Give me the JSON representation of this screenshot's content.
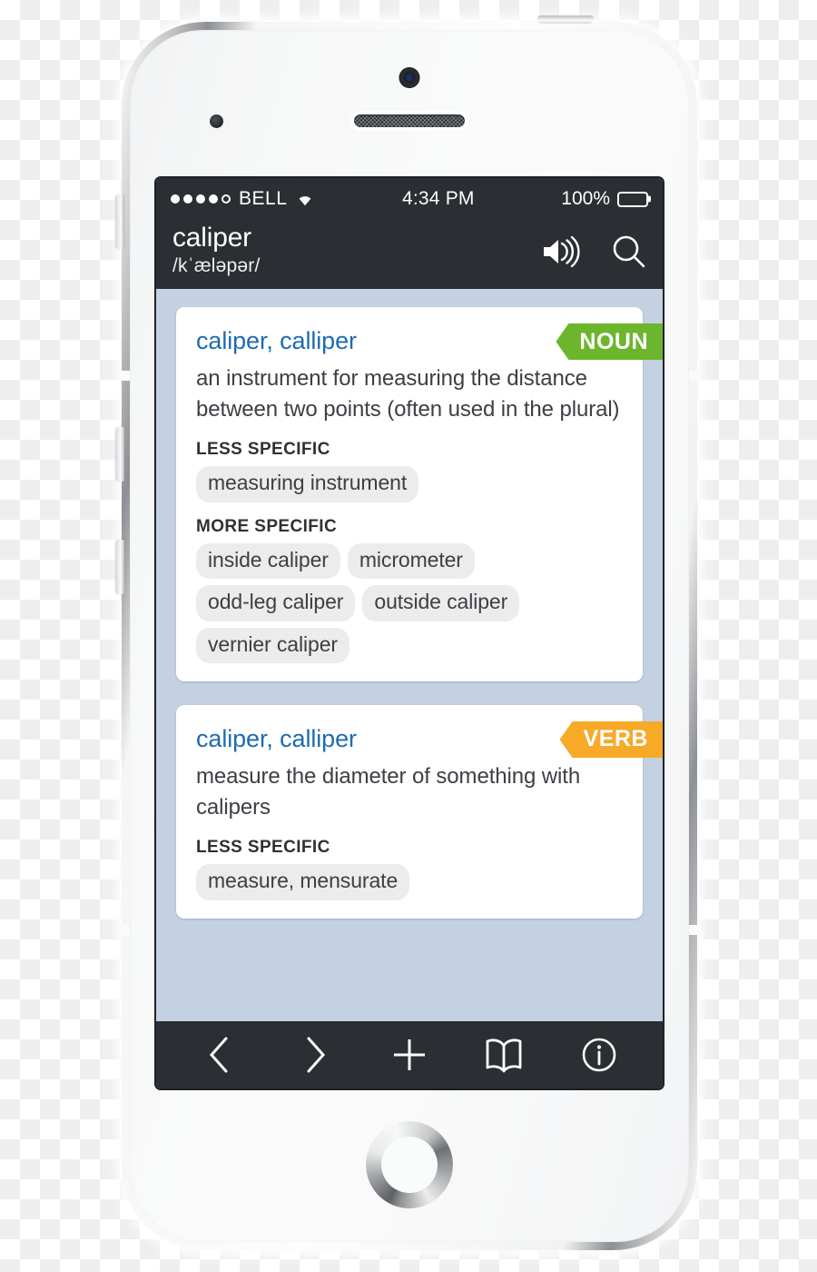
{
  "device": {
    "type": "white-smartphone",
    "hardware": {
      "camera": "front-camera",
      "earpiece": "earpiece-speaker",
      "sensor": "proximity-sensor",
      "home": "home-button",
      "mute": "mute-switch",
      "volume_up": "volume-up-button",
      "volume_down": "volume-down-button",
      "power": "power-button"
    }
  },
  "statusbar": {
    "signal_dots_total": 5,
    "signal_dots_filled": 4,
    "carrier": "BELL",
    "wifi_icon": "wifi-icon",
    "time": "4:34 PM",
    "battery_percent": "100%",
    "battery_level": 100
  },
  "navbar": {
    "headword": "caliper",
    "phonetic": "/kˈæləpər/",
    "speaker_icon": "speaker-icon",
    "search_icon": "search-icon"
  },
  "colors": {
    "chrome_dark": "#2b2e33",
    "screen_bg": "#c3d1e2",
    "headword_blue": "#1f6bb0",
    "noun_green": "#6cb52d",
    "verb_orange": "#f7a928",
    "chip_grey": "#ececec"
  },
  "entries": [
    {
      "word": "caliper, calliper",
      "pos_badge": "NOUN",
      "badge_color": "#6cb52d",
      "definition": "an instrument for measuring the distance between two points (often used in the plural)",
      "relations": [
        {
          "label": "LESS SPECIFIC",
          "terms": [
            "measuring instrument"
          ]
        },
        {
          "label": "MORE SPECIFIC",
          "terms": [
            "inside caliper",
            "micrometer",
            "odd-leg caliper",
            "outside caliper",
            "vernier caliper"
          ]
        }
      ]
    },
    {
      "word": "caliper, calliper",
      "pos_badge": "VERB",
      "badge_color": "#f7a928",
      "definition": "measure the diameter of something with calipers",
      "relations": [
        {
          "label": "LESS SPECIFIC",
          "terms": [
            "measure, mensurate"
          ]
        }
      ]
    }
  ],
  "toolbar": {
    "buttons": [
      {
        "name": "back-button",
        "icon": "chevron-left-icon"
      },
      {
        "name": "forward-button",
        "icon": "chevron-right-icon"
      },
      {
        "name": "add-button",
        "icon": "plus-icon"
      },
      {
        "name": "bookmarks-button",
        "icon": "book-icon"
      },
      {
        "name": "info-button",
        "icon": "info-icon"
      }
    ]
  }
}
